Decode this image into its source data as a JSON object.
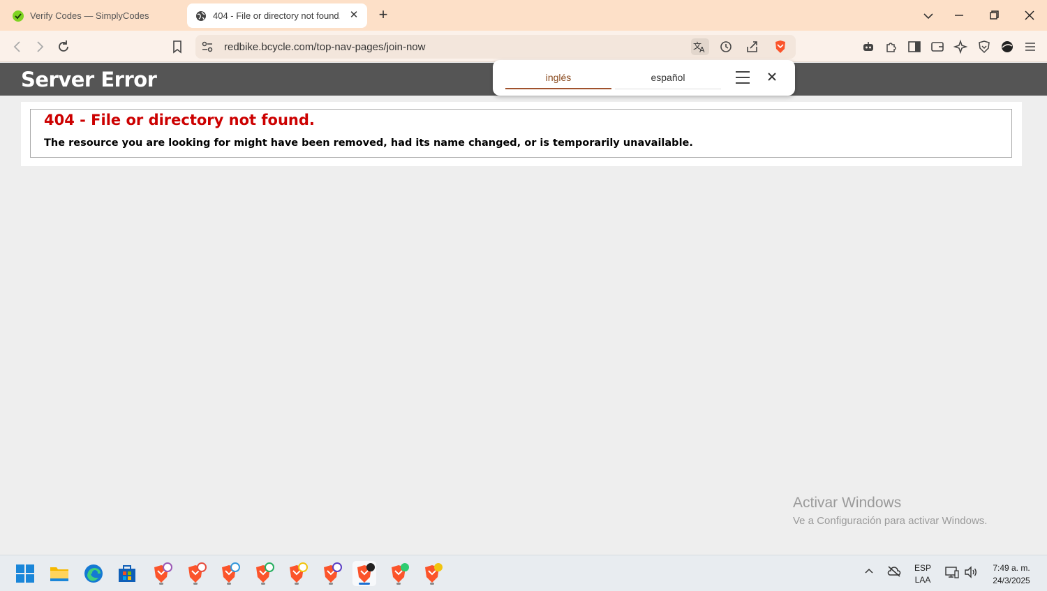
{
  "browser": {
    "tabs": [
      {
        "title": "Verify Codes — SimplyCodes",
        "active": false,
        "favicon": "simplycodes-icon"
      },
      {
        "title": "404 - File or directory not found.",
        "active": true,
        "favicon": "globe-icon"
      }
    ],
    "address": {
      "url": "redbike.bcycle.com/top-nav-pages/join-now"
    }
  },
  "translate_popup": {
    "languages": [
      "inglés",
      "español"
    ],
    "selected": "inglés"
  },
  "page": {
    "header_title": "Server Error",
    "error_title": "404 - File or directory not found.",
    "error_message": "The resource you are looking for might have been removed, had its name changed, or is temporarily unavailable."
  },
  "watermark": {
    "title": "Activar Windows",
    "subtitle": "Ve a Configuración para activar Windows."
  },
  "taskbar": {
    "language_line1": "ESP",
    "language_line2": "LAA",
    "time": "7:49 a. m.",
    "date": "24/3/2025"
  },
  "colors": {
    "tab_strip": "#fde0c8",
    "toolbar": "#fbf1ea",
    "server_header": "#555555",
    "error_red": "#cc0000",
    "translate_accent": "#a0522d",
    "brave_orange": "#fb542b"
  }
}
